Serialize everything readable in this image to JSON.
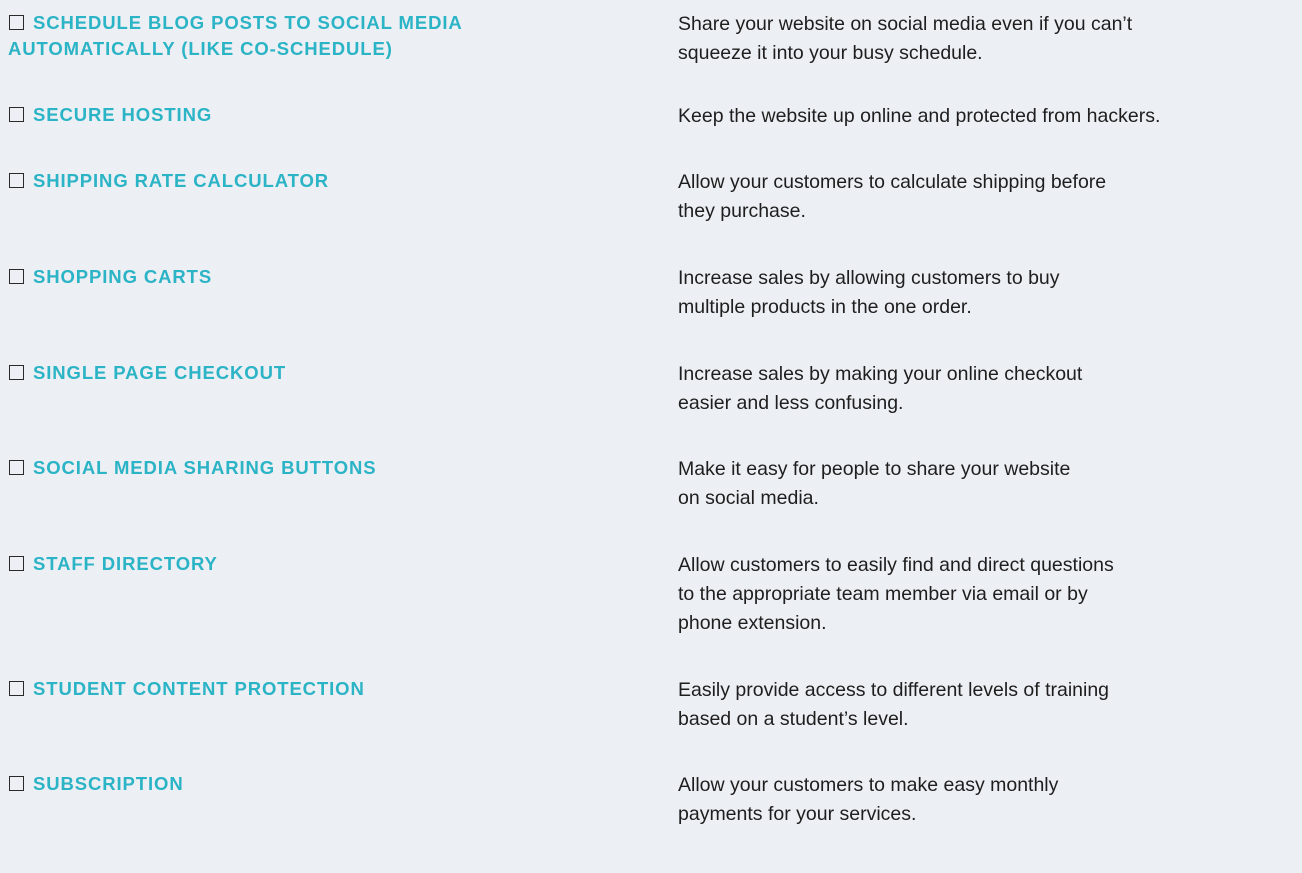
{
  "features": [
    {
      "title_lines": [
        "SCHEDULE BLOG POSTS TO SOCIAL MEDIA",
        "AUTOMATICALLY (LIKE CO-SCHEDULE)"
      ],
      "desc_lines": [
        "Share your website on social media even if you can’t",
        "squeeze it into your busy schedule."
      ]
    },
    {
      "title_lines": [
        "SECURE HOSTING"
      ],
      "desc_lines": [
        "Keep the website up online and protected from hackers."
      ]
    },
    {
      "title_lines": [
        "SHIPPING RATE CALCULATOR"
      ],
      "desc_lines": [
        "Allow your customers to calculate shipping before",
        "they purchase."
      ]
    },
    {
      "title_lines": [
        "SHOPPING CARTS"
      ],
      "desc_lines": [
        "Increase sales by allowing customers to buy",
        "multiple products in the one order."
      ]
    },
    {
      "title_lines": [
        "SINGLE PAGE CHECKOUT"
      ],
      "desc_lines": [
        "Increase sales by making your online checkout",
        "easier and less confusing."
      ]
    },
    {
      "title_lines": [
        "SOCIAL MEDIA SHARING BUTTONS"
      ],
      "desc_lines": [
        "Make it easy for people to share your website",
        "on social media."
      ]
    },
    {
      "title_lines": [
        "STAFF DIRECTORY"
      ],
      "desc_lines": [
        "Allow customers to easily find and direct questions",
        "to the appropriate team member via email or by",
        "phone extension."
      ]
    },
    {
      "title_lines": [
        "STUDENT CONTENT PROTECTION"
      ],
      "desc_lines": [
        "Easily provide access to different levels of training",
        "based on a student’s level."
      ]
    },
    {
      "title_lines": [
        "SUBSCRIPTION"
      ],
      "desc_lines": [
        "Allow your customers to make easy monthly",
        "payments for your services."
      ]
    }
  ]
}
